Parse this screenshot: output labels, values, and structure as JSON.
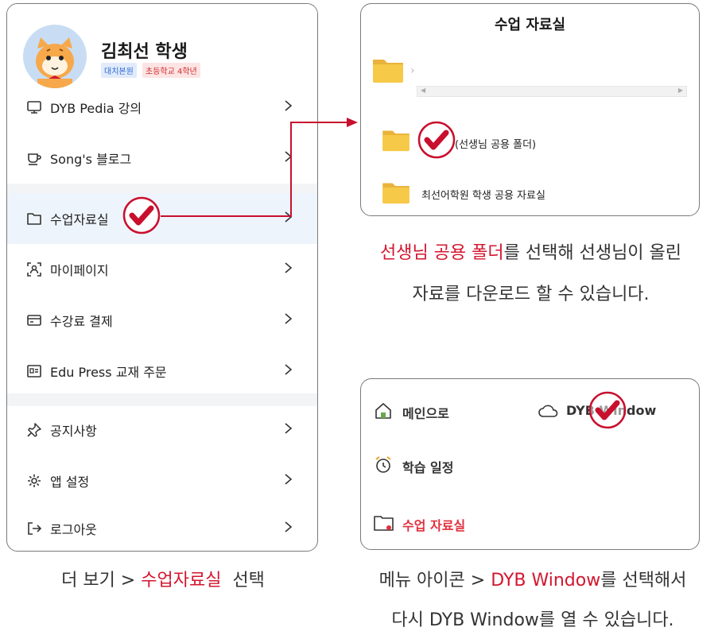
{
  "profile": {
    "name": "김최선 학생",
    "branch_badge": "대치본원",
    "grade_badge": "초등학교 4학년"
  },
  "menu": {
    "items": [
      {
        "label": "DYB Pedia 강의",
        "icon": "monitor-icon"
      },
      {
        "label": "Song's 블로그",
        "icon": "cup-icon"
      },
      {
        "label": "수업자료실",
        "icon": "folder-icon"
      },
      {
        "label": "마이페이지",
        "icon": "user-scan-icon"
      },
      {
        "label": "수강료 결제",
        "icon": "card-icon"
      },
      {
        "label": "Edu Press 교재 주문",
        "icon": "id-card-icon"
      },
      {
        "label": "공지사항",
        "icon": "pin-icon"
      },
      {
        "label": "앱 설정",
        "icon": "gear-icon"
      },
      {
        "label": "로그아웃",
        "icon": "logout-icon"
      }
    ]
  },
  "files": {
    "title": "수업 자료실",
    "folders": [
      {
        "label": ""
      },
      {
        "label": "(선생님 공용 폴더)"
      },
      {
        "label": "최선어학원 학생 공용 자료실"
      }
    ]
  },
  "nav": {
    "main": "메인으로",
    "window": "DYB Window",
    "schedule": "학습 일정",
    "materials": "수업 자료실"
  },
  "captions": {
    "left": {
      "pre": "더 보기 > ",
      "hl": "수업자료실",
      "post": "  선택"
    },
    "files_line1": {
      "hl": "선생님 공용 폴더",
      "post": "를 선택해 선생님이 올린"
    },
    "files_line2": "자료를 다운로드 할 수 있습니다.",
    "nav_line1": {
      "pre": "메뉴 아이콘 > ",
      "hl": "DYB Window",
      "post": "를 선택해서"
    },
    "nav_line2": "다시 DYB Window를 열 수 있습니다."
  },
  "colors": {
    "accent_red": "#d3162f",
    "active_bg": "#eef4fb",
    "folder_yellow": "#f7c948"
  }
}
